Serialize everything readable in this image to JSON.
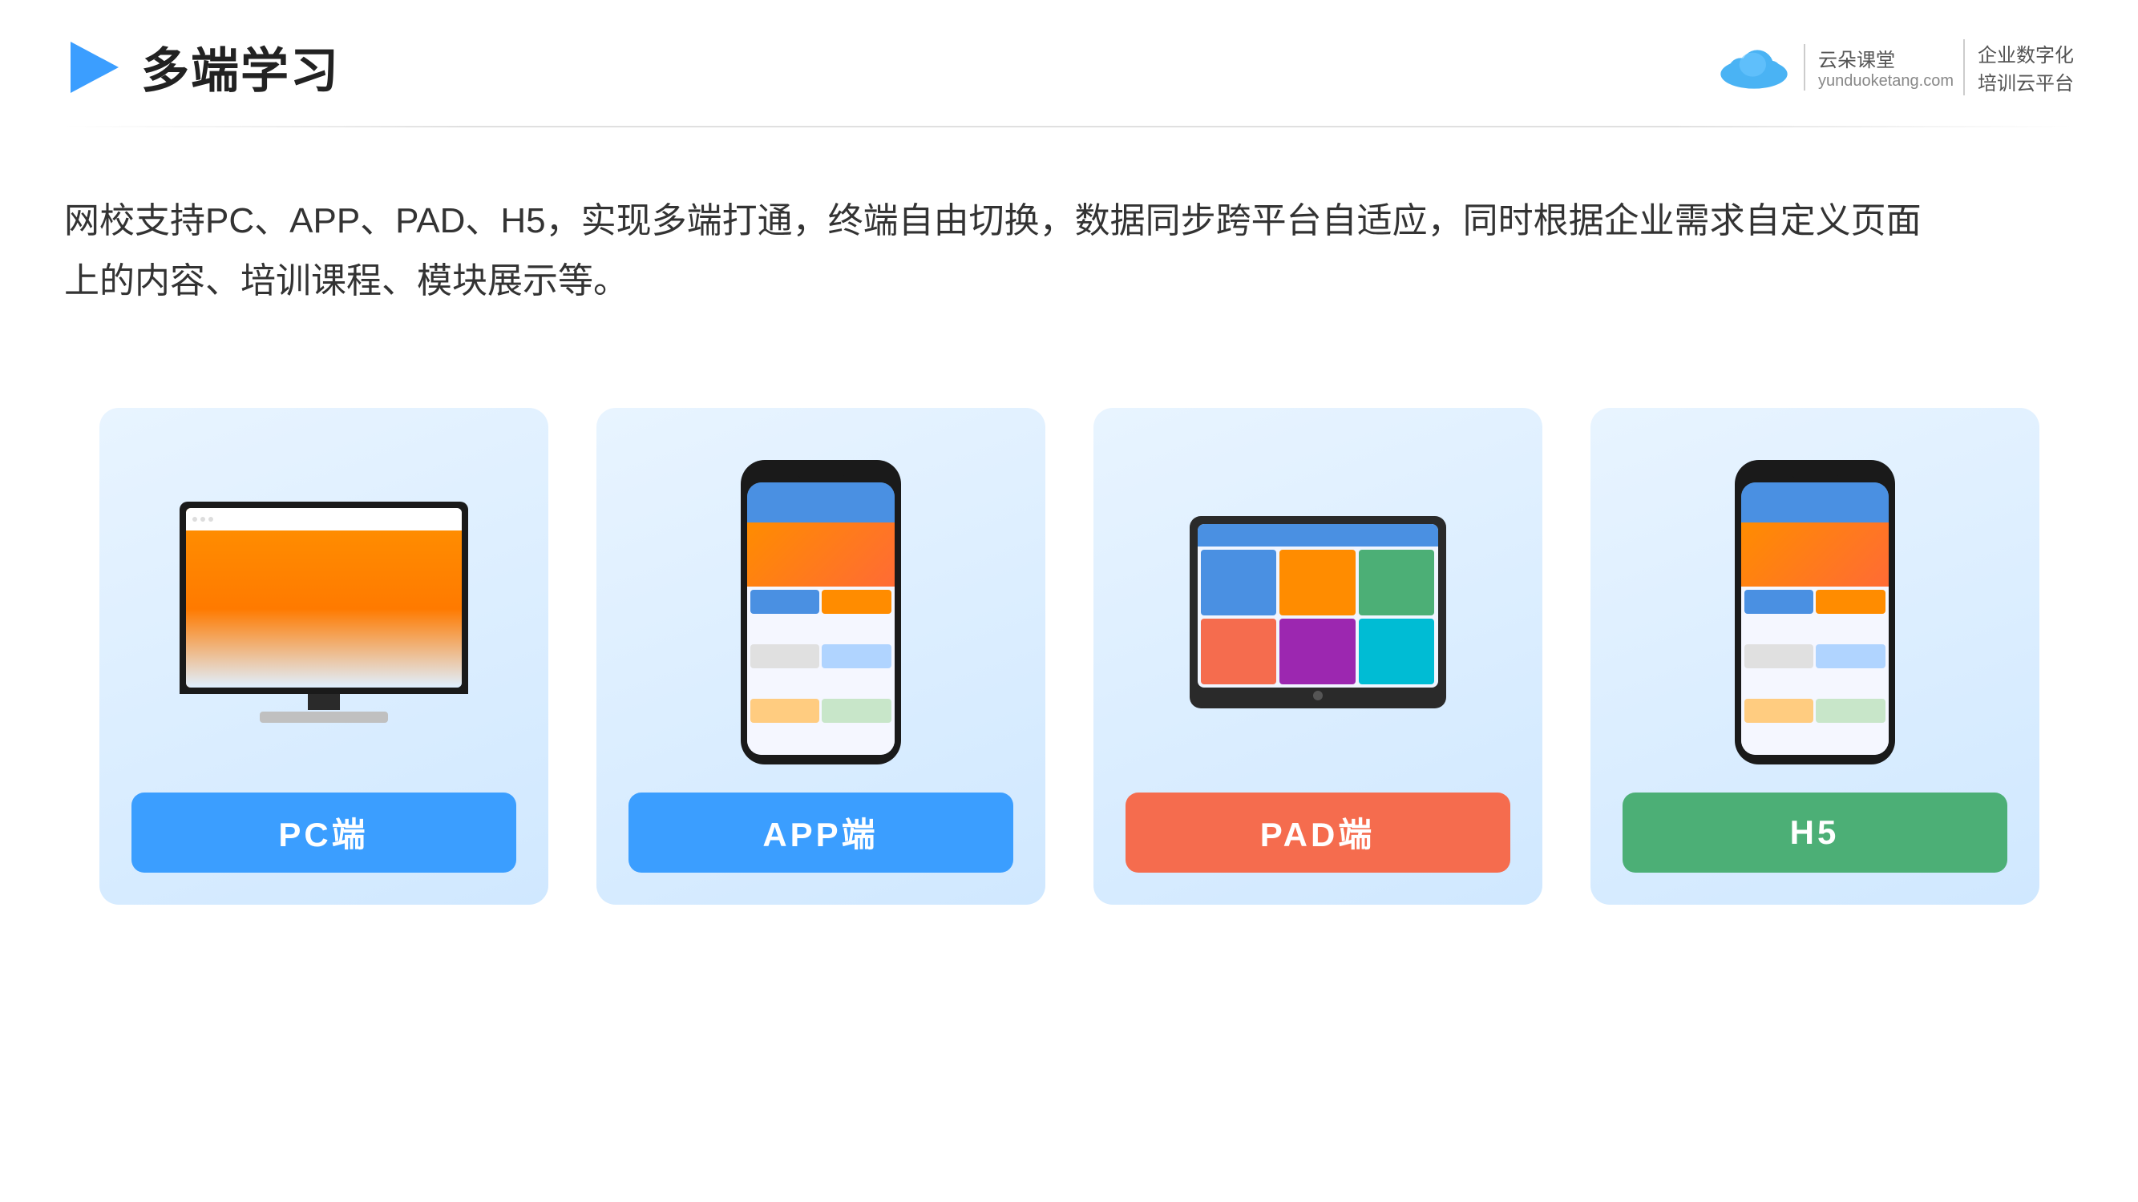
{
  "header": {
    "page_title": "多端学习",
    "logo_url": "yunduoketang.com",
    "logo_main": "云朵课堂",
    "logo_sub": "yunduoketang.com",
    "logo_tagline1": "企业数字化",
    "logo_tagline2": "培训云平台"
  },
  "description": {
    "text_line1": "网校支持PC、APP、PAD、H5，实现多端打通，终端自由切换，数据同步跨平台自适应，同时根据企业需求自定义页面",
    "text_line2": "上的内容、培训课程、模块展示等。"
  },
  "cards": [
    {
      "id": "pc",
      "label": "PC端",
      "button_color": "btn-blue",
      "type": "pc"
    },
    {
      "id": "app",
      "label": "APP端",
      "button_color": "btn-blue",
      "type": "phone"
    },
    {
      "id": "pad",
      "label": "PAD端",
      "button_color": "btn-red",
      "type": "tablet"
    },
    {
      "id": "h5",
      "label": "H5",
      "button_color": "btn-green",
      "type": "phone2"
    }
  ],
  "colors": {
    "accent_blue": "#3b9eff",
    "accent_red": "#f56c4e",
    "accent_green": "#4caf76",
    "background": "#ffffff",
    "card_bg": "#ddeeff"
  }
}
